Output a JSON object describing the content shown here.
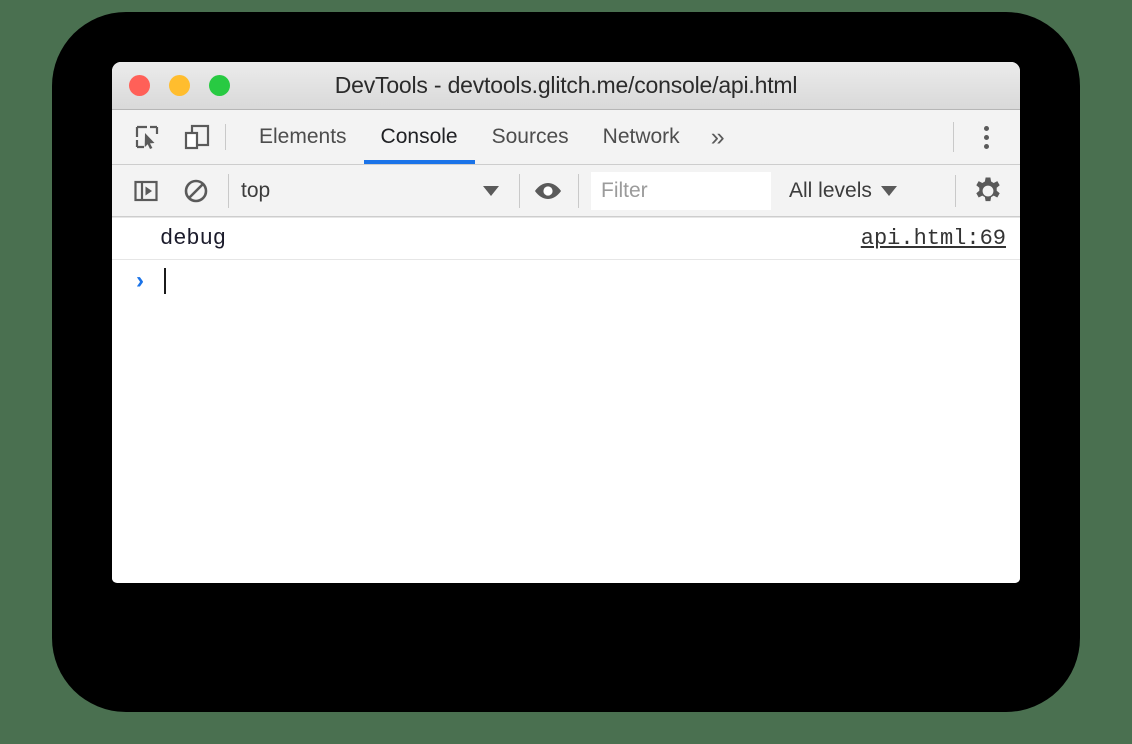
{
  "window": {
    "title": "DevTools - devtools.glitch.me/console/api.html",
    "traffic_lights": [
      {
        "name": "close",
        "color": "#ff6058"
      },
      {
        "name": "minimize",
        "color": "#ffbd2e"
      },
      {
        "name": "zoom",
        "color": "#28ca42"
      }
    ]
  },
  "tabstrip": {
    "inspect_icon": "inspect-element-icon",
    "device_icon": "device-toolbar-icon",
    "tabs": [
      {
        "label": "Elements",
        "active": false
      },
      {
        "label": "Console",
        "active": true
      },
      {
        "label": "Sources",
        "active": false
      },
      {
        "label": "Network",
        "active": false
      }
    ],
    "overflow_label": "»",
    "menu_icon": "more-vertical-icon",
    "active_underline_color": "#1a73e8"
  },
  "console_toolbar": {
    "sidebar_icon": "console-sidebar-icon",
    "clear_icon": "clear-console-icon",
    "context": "top",
    "eye_icon": "live-expression-eye-icon",
    "filter": {
      "value": "",
      "placeholder": "Filter"
    },
    "levels": "All levels",
    "settings_icon": "settings-gear-icon"
  },
  "console": {
    "messages": [
      {
        "text": "debug",
        "source": "api.html:69"
      }
    ],
    "prompt_chevron": "›"
  },
  "colors": {
    "background": "#4a7050",
    "backdrop": "#000000",
    "accent": "#1a73e8"
  }
}
